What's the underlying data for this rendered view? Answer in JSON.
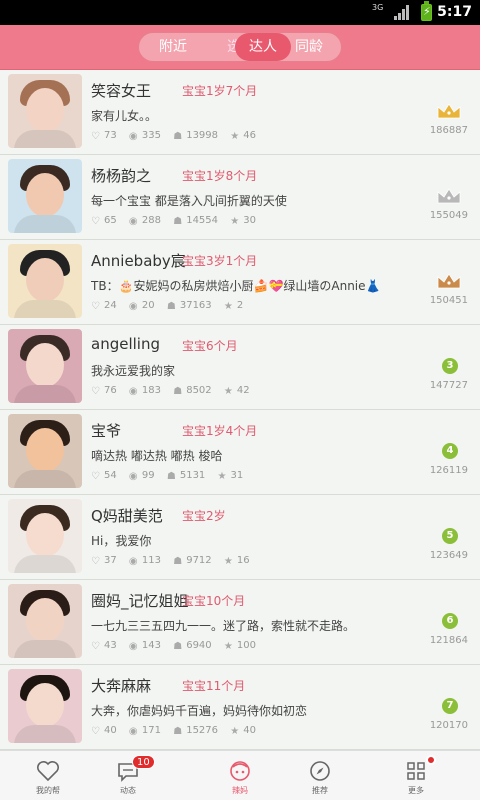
{
  "status_bar": {
    "network": "3G",
    "time": "5:17"
  },
  "header": {
    "tabs": [
      {
        "label": "附近",
        "active": false
      },
      {
        "label": "选",
        "active": false
      },
      {
        "label": "达人",
        "active": true
      },
      {
        "label": "同龄",
        "active": false
      }
    ]
  },
  "users": [
    {
      "name": "笑容女王",
      "age": "宝宝1岁7个月",
      "desc": "家有儿女。。",
      "likes": "73",
      "views": "335",
      "visits": "13998",
      "stars": "46",
      "rank_type": "crown-gold",
      "score": "186887"
    },
    {
      "name": "杨杨韵之",
      "age": "宝宝1岁8个月",
      "desc": "每一个宝宝 都是落入凡间折翼的天使",
      "likes": "65",
      "views": "288",
      "visits": "14554",
      "stars": "30",
      "rank_type": "crown-silver",
      "score": "155049"
    },
    {
      "name": "Anniebaby宸",
      "age": "宝宝3岁1个月",
      "desc": "TB：🎂安妮妈の私房烘焙小厨🍰💝绿山墙のAnnie👗",
      "likes": "24",
      "views": "20",
      "visits": "37163",
      "stars": "2",
      "rank_type": "crown-bronze",
      "score": "150451"
    },
    {
      "name": "angelling",
      "age": "宝宝6个月",
      "desc": "我永远爱我的家",
      "likes": "76",
      "views": "183",
      "visits": "8502",
      "stars": "42",
      "rank_type": "badge",
      "rank": "3",
      "score": "147727"
    },
    {
      "name": "宝爷",
      "age": "宝宝1岁4个月",
      "desc": "嘀达热 嘟达热 嘟热 梭哈",
      "likes": "54",
      "views": "99",
      "visits": "5131",
      "stars": "31",
      "rank_type": "badge",
      "rank": "4",
      "score": "126119"
    },
    {
      "name": "Q妈甜美范",
      "age": "宝宝2岁",
      "desc": "Hi，我爱你",
      "likes": "37",
      "views": "113",
      "visits": "9712",
      "stars": "16",
      "rank_type": "badge",
      "rank": "5",
      "score": "123649"
    },
    {
      "name": "圈妈_记忆姐姐",
      "age": "宝宝10个月",
      "desc": "一七九三三五四九一一。迷了路，索性就不走路。",
      "likes": "43",
      "views": "143",
      "visits": "6940",
      "stars": "100",
      "rank_type": "badge",
      "rank": "6",
      "score": "121864"
    },
    {
      "name": "大奔麻麻",
      "age": "宝宝11个月",
      "desc": "大奔，你虐妈妈千百遍，妈妈待你如初恋",
      "likes": "40",
      "views": "171",
      "visits": "15276",
      "stars": "40",
      "rank_type": "badge",
      "rank": "7",
      "score": "120170"
    }
  ],
  "tabbar": {
    "items": [
      {
        "label": "我的帮",
        "icon": "heart-icon"
      },
      {
        "label": "动态",
        "icon": "chat-icon",
        "badge": "10"
      },
      {
        "label": "辣妈",
        "icon": "mom-icon",
        "active": true
      },
      {
        "label": "推荐",
        "icon": "compass-icon"
      },
      {
        "label": "更多",
        "icon": "grid-icon"
      }
    ]
  },
  "colors": {
    "accent": "#ef7a8b",
    "age_text": "#e05a70",
    "badge_green": "#8bbf3a"
  }
}
